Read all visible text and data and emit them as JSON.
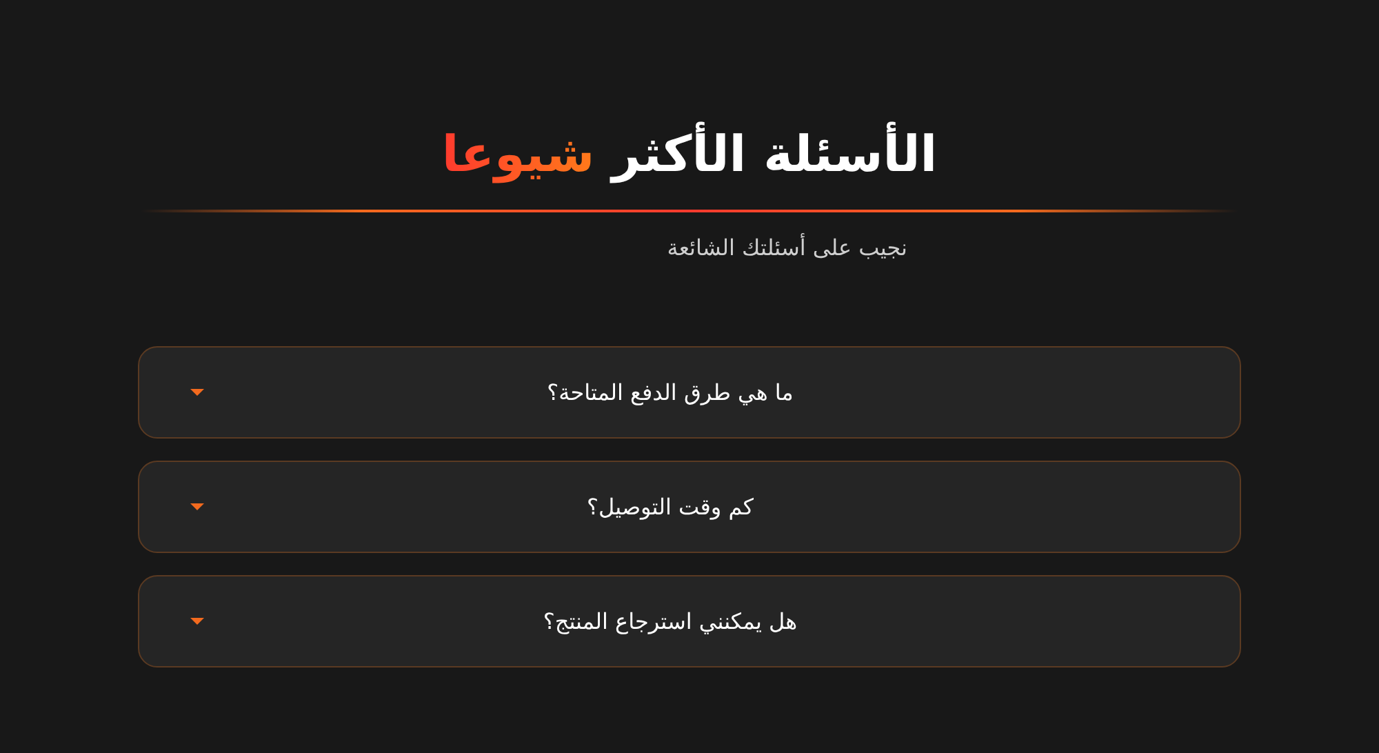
{
  "heading": {
    "text": "الأسئلة الأكثر",
    "highlight": "شيوعا"
  },
  "subtitle": "نجيب على أسئلتك الشائعة",
  "faq": [
    {
      "question": "ما هي طرق الدفع المتاحة؟",
      "expanded": false
    },
    {
      "question": "كم وقت التوصيل؟",
      "expanded": false
    },
    {
      "question": "هل يمكنني استرجاع المنتج؟",
      "expanded": false
    }
  ]
}
